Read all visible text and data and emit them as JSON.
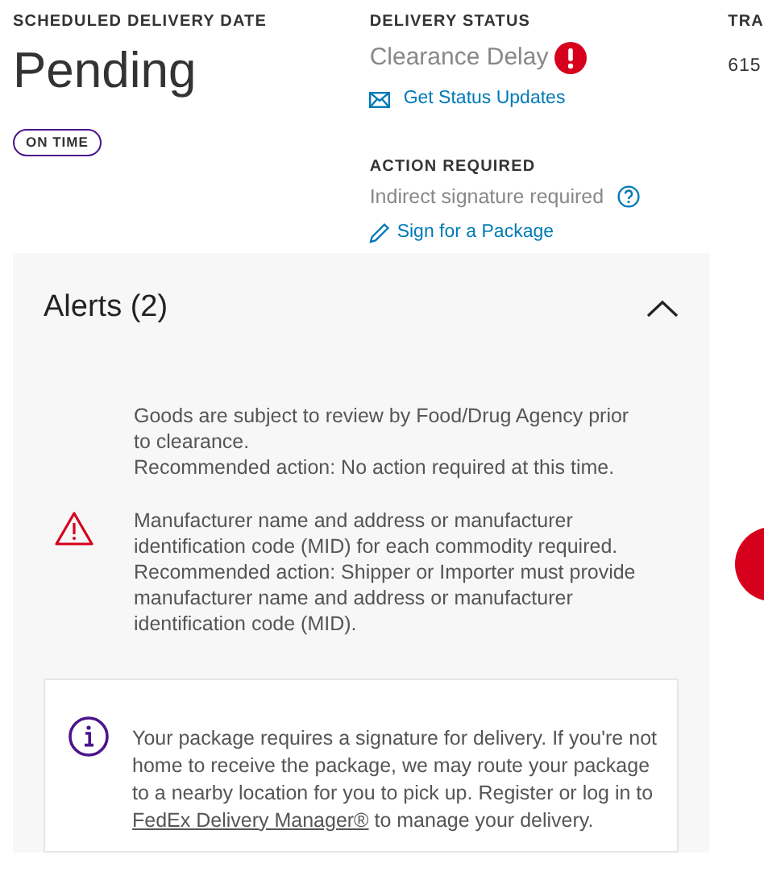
{
  "scheduled_delivery": {
    "label": "SCHEDULED DELIVERY DATE",
    "value": "Pending",
    "badge": "ON TIME"
  },
  "delivery_status": {
    "label": "DELIVERY STATUS",
    "value": "Clearance Delay",
    "alert": true,
    "link": "Get Status Updates"
  },
  "action_required": {
    "label": "ACTION REQUIRED",
    "value": "Indirect signature required",
    "link": "Sign for a Package"
  },
  "tracking": {
    "label": "TRA",
    "value": "615"
  },
  "alerts_panel": {
    "title": "Alerts (2)",
    "expanded": true,
    "alerts": [
      {
        "kind": "warning",
        "messages": [
          {
            "lines": [
              "Goods are subject to review by Food/Drug Agency prior to clearance.",
              "Recommended action: No action required at this time."
            ]
          },
          {
            "lines": [
              "Manufacturer name and address or manufacturer identification code (MID) for each commodity required.",
              "Recommended action: Shipper or Importer must provide manufacturer name and address or manufacturer identification code (MID)."
            ]
          }
        ]
      }
    ],
    "info": {
      "kind": "info",
      "text": "Your package requires a signature for delivery. If you're not home to receive the package, we may route your package to a nearby location for you to pick up. Register or log in to",
      "link": "FedEx Delivery Manager®",
      "text_after": "to manage your delivery."
    }
  }
}
